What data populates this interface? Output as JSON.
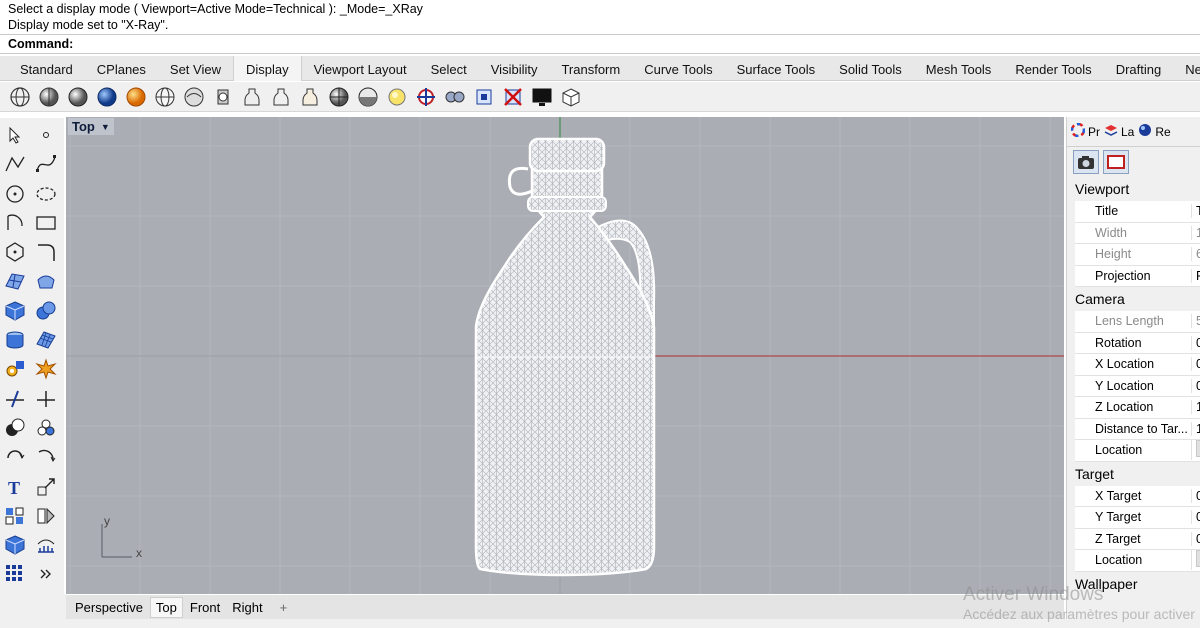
{
  "command": {
    "history": [
      "Select a display mode ( Viewport=Active  Mode=Technical ): _Mode=_XRay",
      "Display mode set to \"X-Ray\"."
    ],
    "prompt": "Command:"
  },
  "tabs": [
    "Standard",
    "CPlanes",
    "Set View",
    "Display",
    "Viewport Layout",
    "Select",
    "Visibility",
    "Transform",
    "Curve Tools",
    "Surface Tools",
    "Solid Tools",
    "Mesh Tools",
    "Render Tools",
    "Drafting",
    "New"
  ],
  "active_tab": "Display",
  "viewport": {
    "label": "Top",
    "axis_x": "x",
    "axis_y": "y",
    "display_mode": "X-Ray",
    "background_color": "#aaadb4",
    "x_axis_color": "#b03030",
    "y_axis_color": "#2e8b3a"
  },
  "viewport_tabs": [
    "Perspective",
    "Top",
    "Front",
    "Right"
  ],
  "active_viewport_tab": "Top",
  "viewport_add_symbol": "+",
  "right_panel": {
    "tabs": [
      {
        "label": "Pr",
        "icon": "color-wheel-icon"
      },
      {
        "label": "La",
        "icon": "layers-icon"
      },
      {
        "label": "Re",
        "icon": "render-icon"
      }
    ],
    "sections": [
      {
        "title": "Viewport",
        "rows": [
          {
            "label": "Title",
            "value": "To",
            "dim": false
          },
          {
            "label": "Width",
            "value": "1",
            "dim": true
          },
          {
            "label": "Height",
            "value": "6",
            "dim": true
          },
          {
            "label": "Projection",
            "value": "P",
            "dim": false
          }
        ]
      },
      {
        "title": "Camera",
        "rows": [
          {
            "label": "Lens Length",
            "value": "5",
            "dim": true
          },
          {
            "label": "Rotation",
            "value": "0",
            "dim": false
          },
          {
            "label": "X Location",
            "value": "0",
            "dim": false
          },
          {
            "label": "Y Location",
            "value": "0",
            "dim": false
          },
          {
            "label": "Z Location",
            "value": "1",
            "dim": false
          },
          {
            "label": "Distance to Tar...",
            "value": "1",
            "dim": false
          },
          {
            "label": "Location",
            "value": "",
            "dim": false,
            "button": true
          }
        ]
      },
      {
        "title": "Target",
        "rows": [
          {
            "label": "X Target",
            "value": "0",
            "dim": false
          },
          {
            "label": "Y Target",
            "value": "0",
            "dim": false
          },
          {
            "label": "Z Target",
            "value": "0",
            "dim": false
          },
          {
            "label": "Location",
            "value": "",
            "dim": false,
            "button": true
          }
        ]
      },
      {
        "title": "Wallpaper",
        "rows": []
      }
    ]
  },
  "watermark": {
    "line1": "Activer Windows",
    "line2": "Accédez aux paramètres pour activer"
  }
}
